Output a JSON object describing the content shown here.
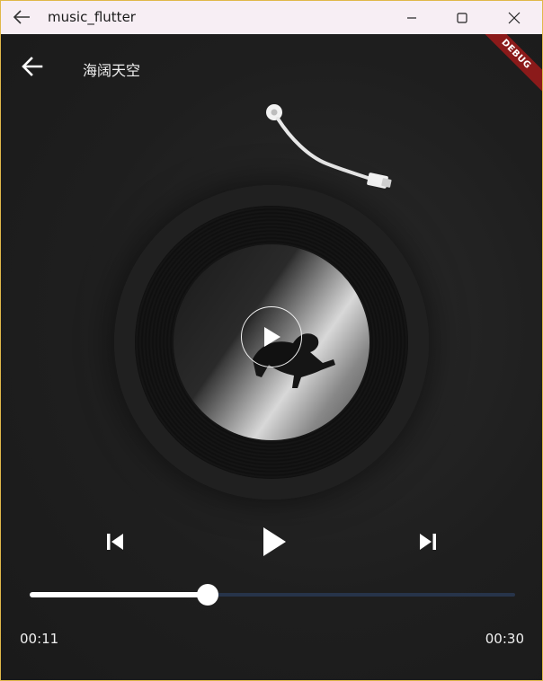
{
  "window": {
    "title": "music_flutter",
    "minimize_icon": "minimize-icon",
    "maximize_icon": "maximize-icon",
    "close_icon": "close-icon"
  },
  "app": {
    "song_title": "海阔天空",
    "debug_label": "DEBUG",
    "accent_color": "#ffffff",
    "track_color": "#27344a"
  },
  "player": {
    "current_time": "00:11",
    "total_time": "00:30",
    "progress": 0.367,
    "state": "paused"
  }
}
